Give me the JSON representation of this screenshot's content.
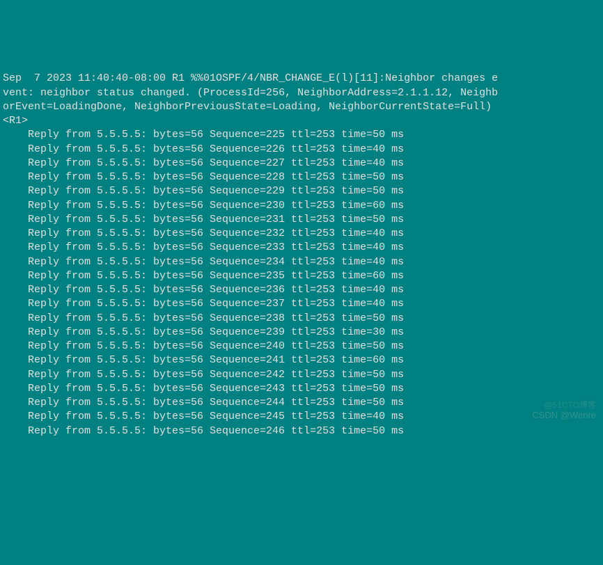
{
  "log": {
    "line1": "Sep  7 2023 11:40:40-08:00 R1 %%01OSPF/4/NBR_CHANGE_E(l)[11]:Neighbor changes e",
    "line2": "vent: neighbor status changed. (ProcessId=256, NeighborAddress=2.1.1.12, Neighb",
    "line3": "orEvent=LoadingDone, NeighborPreviousState=Loading, NeighborCurrentState=Full)",
    "prompt": "<R1>"
  },
  "ping": {
    "host": "5.5.5.5",
    "bytes": "56",
    "ttl": "253",
    "replies": [
      {
        "seq": "225",
        "time": "50"
      },
      {
        "seq": "226",
        "time": "40"
      },
      {
        "seq": "227",
        "time": "40"
      },
      {
        "seq": "228",
        "time": "50"
      },
      {
        "seq": "229",
        "time": "50"
      },
      {
        "seq": "230",
        "time": "60"
      },
      {
        "seq": "231",
        "time": "50"
      },
      {
        "seq": "232",
        "time": "40"
      },
      {
        "seq": "233",
        "time": "40"
      },
      {
        "seq": "234",
        "time": "40"
      },
      {
        "seq": "235",
        "time": "60"
      },
      {
        "seq": "236",
        "time": "40"
      },
      {
        "seq": "237",
        "time": "40"
      },
      {
        "seq": "238",
        "time": "50"
      },
      {
        "seq": "239",
        "time": "30"
      },
      {
        "seq": "240",
        "time": "50"
      },
      {
        "seq": "241",
        "time": "60"
      },
      {
        "seq": "242",
        "time": "50"
      },
      {
        "seq": "243",
        "time": "50"
      },
      {
        "seq": "244",
        "time": "50"
      },
      {
        "seq": "245",
        "time": "40"
      },
      {
        "seq": "246",
        "time": "50"
      }
    ]
  },
  "watermark": {
    "top": "@51CTO博客",
    "bottom": "CSDN @Wenre"
  }
}
